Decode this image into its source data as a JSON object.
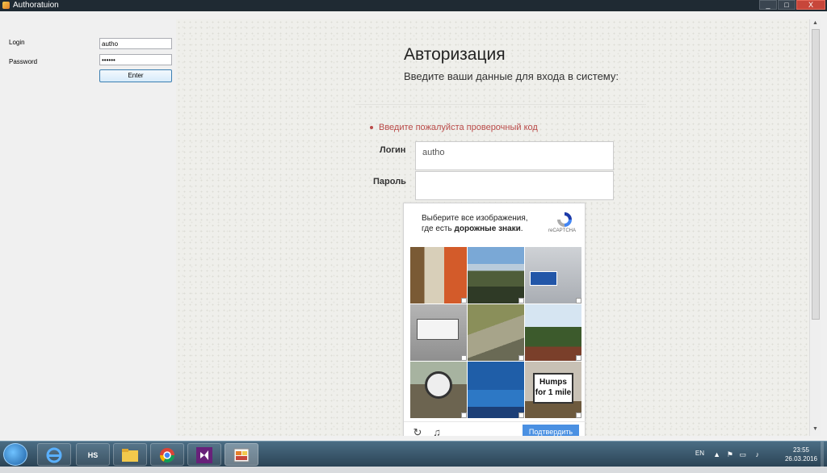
{
  "window": {
    "title": "Authoratuion",
    "controls": [
      "_",
      "□",
      "X"
    ]
  },
  "form": {
    "login_label": "Login",
    "login_value": "autho",
    "password_label": "Password",
    "password_value": "••••••",
    "enter_label": "Enter"
  },
  "page": {
    "title": "Авторизация",
    "subtitle": "Введите ваши данные для входа в систему:",
    "error": "Введите пожалуйста проверочный код",
    "login_label": "Логин",
    "login_value": "autho",
    "password_label": "Пароль",
    "password_value": ""
  },
  "captcha": {
    "instruction_line1": "Выберите все изображения,",
    "instruction_line2_prefix": "где есть ",
    "instruction_bold": "дорожные знаки",
    "instruction_suffix": ".",
    "logo_label": "reCAPTCHA",
    "verify_label": "Подтвердить",
    "humps_sign": "Humps for 1 mile",
    "reload_icon": "reload-icon",
    "audio_icon": "headphones-icon"
  },
  "taskbar": {
    "apps": [
      "internet-explorer",
      "hs-app",
      "file-explorer",
      "chrome",
      "visual-studio",
      "winforms-app"
    ],
    "hs_label": "HS",
    "language": "EN",
    "time": "23:55",
    "date": "26.03.2016"
  },
  "colors": {
    "accent": "#4a90e2",
    "error": "#b94a48",
    "titlebar": "#1f2a33"
  }
}
